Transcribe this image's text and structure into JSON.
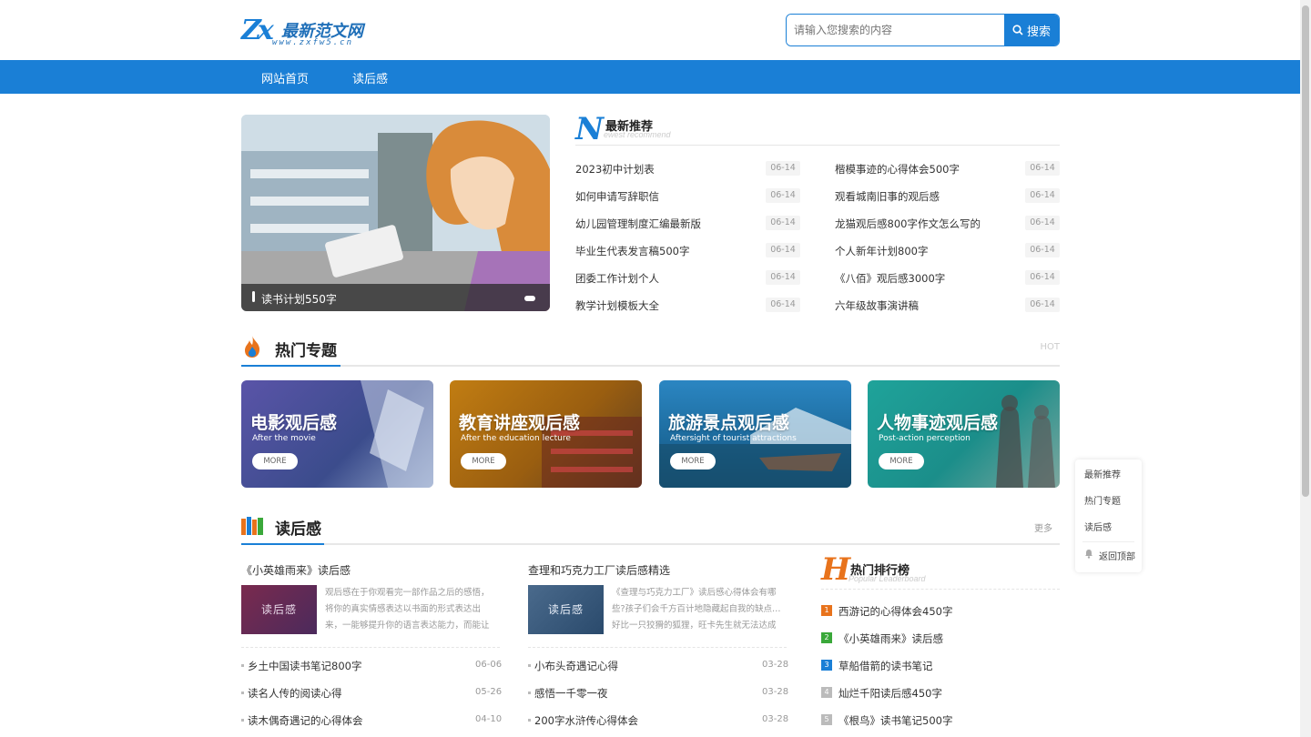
{
  "header": {
    "logo_mark": "Zx",
    "logo_name": "最新范文网",
    "logo_url": "www.zxfw5.cn",
    "search_placeholder": "请输入您搜索的内容",
    "search_button": "搜索"
  },
  "nav": {
    "items": [
      "网站首页",
      "读后感"
    ]
  },
  "banner": {
    "caption": "读书计划550字"
  },
  "newest": {
    "letter": "N",
    "title": "最新推荐",
    "subtitle": "ewest recommend",
    "left": [
      {
        "title": "2023初中计划表",
        "date": "06-14"
      },
      {
        "title": "如何申请写辞职信",
        "date": "06-14"
      },
      {
        "title": "幼儿园管理制度汇编最新版",
        "date": "06-14"
      },
      {
        "title": "毕业生代表发言稿500字",
        "date": "06-14"
      },
      {
        "title": "团委工作计划个人",
        "date": "06-14"
      },
      {
        "title": "教学计划模板大全",
        "date": "06-14"
      }
    ],
    "right": [
      {
        "title": "楷模事迹的心得体会500字",
        "date": "06-14"
      },
      {
        "title": "观看城南旧事的观后感",
        "date": "06-14"
      },
      {
        "title": "龙猫观后感800字作文怎么写的",
        "date": "06-14"
      },
      {
        "title": "个人新年计划800字",
        "date": "06-14"
      },
      {
        "title": "《八佰》观后感3000字",
        "date": "06-14"
      },
      {
        "title": "六年级故事演讲稿",
        "date": "06-14"
      }
    ]
  },
  "hot": {
    "title": "热门专题",
    "right_label": "HOT",
    "cards": [
      {
        "title": "电影观后感",
        "en": "After the movie",
        "more": "MORE",
        "color": "#4a4f9a"
      },
      {
        "title": "教育讲座观后感",
        "en": "After the education lecture",
        "more": "MORE",
        "color": "#b77610"
      },
      {
        "title": "旅游景点观后感",
        "en": "Aftersight of tourist attractions",
        "more": "MORE",
        "color": "#1f73a6"
      },
      {
        "title": "人物事迹观后感",
        "en": "Post-action perception",
        "more": "MORE",
        "color": "#1e958f"
      }
    ]
  },
  "float_menu": [
    "最新推荐",
    "热门专题",
    "读后感",
    "返回顶部"
  ],
  "reading": {
    "title": "读后感",
    "more": "更多",
    "col1": {
      "feature_title": "《小英雄雨来》读后感",
      "thumb_text": "读后感",
      "excerpt": "观后感在于你观看完一部作品之后的感悟，将你的真实情感表达以书面的形式表达出来，一能够提升你的语言表达能力，而能让",
      "items": [
        {
          "title": "乡土中国读书笔记800字",
          "date": "06-06"
        },
        {
          "title": "读名人传的阅读心得",
          "date": "05-26"
        },
        {
          "title": "读木偶奇遇记的心得体会",
          "date": "04-10"
        }
      ]
    },
    "col2": {
      "feature_title": "查理和巧克力工厂读后感精选",
      "thumb_text": "读后感",
      "excerpt": "《查理与巧克力工厂》读后感心得体会有哪些?孩子们会千方百计地隐藏起自我的缺点…好比一只狡猾的狐狸，旺卡先生就无法达成",
      "items": [
        {
          "title": "小布头奇遇记心得",
          "date": "03-28"
        },
        {
          "title": "感悟一千零一夜",
          "date": "03-28"
        },
        {
          "title": "200字水浒传心得体会",
          "date": "03-28"
        }
      ]
    }
  },
  "ranking": {
    "letter": "H",
    "title": "热门排行榜",
    "subtitle": "Popular Leaderboard",
    "items": [
      {
        "rank": "1",
        "title": "西游记的心得体会450字",
        "color": "#e8731c"
      },
      {
        "rank": "2",
        "title": "《小英雄雨来》读后感",
        "color": "#3aa83a"
      },
      {
        "rank": "3",
        "title": "草船借箭的读书笔记",
        "color": "#1a7fd6"
      },
      {
        "rank": "4",
        "title": "灿烂千阳读后感450字",
        "color": "#bbbbbb"
      },
      {
        "rank": "5",
        "title": "《根鸟》读书笔记500字",
        "color": "#bbbbbb"
      }
    ]
  }
}
